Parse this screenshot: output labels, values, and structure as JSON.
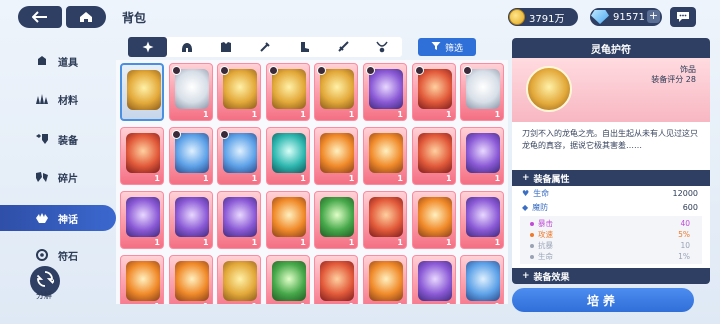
{
  "header": {
    "title": "背包",
    "back_icon": "arrow-left-icon",
    "home_icon": "home-icon",
    "gold": "3791万",
    "gems": "91571",
    "plus_label": "+",
    "chat_icon": "chat-icon"
  },
  "sidebar": {
    "items": [
      {
        "label": "道具",
        "icon": "items-icon"
      },
      {
        "label": "材料",
        "icon": "materials-icon"
      },
      {
        "label": "装备",
        "icon": "equipment-icon"
      },
      {
        "label": "碎片",
        "icon": "fragments-icon"
      },
      {
        "label": "神话",
        "icon": "mythic-icon",
        "active": true
      },
      {
        "label": "符石",
        "icon": "rune-icon"
      }
    ],
    "recycle_label": "分解"
  },
  "filter": {
    "tabs": [
      "all-icon",
      "helmet-icon",
      "armor-icon",
      "weapon-icon",
      "boots-icon",
      "sword-icon",
      "necklace-icon"
    ],
    "filter_label": "筛选"
  },
  "grid": {
    "items": [
      {
        "color": "gold",
        "qty": "",
        "selected": true,
        "mark": false
      },
      {
        "color": "silver",
        "qty": "1",
        "mark": true
      },
      {
        "color": "gold",
        "qty": "1",
        "mark": true
      },
      {
        "color": "gold",
        "qty": "1",
        "mark": true
      },
      {
        "color": "gold",
        "qty": "1",
        "mark": true
      },
      {
        "color": "purple",
        "qty": "1",
        "mark": true
      },
      {
        "color": "red",
        "qty": "1",
        "mark": true
      },
      {
        "color": "silver",
        "qty": "1",
        "mark": true
      },
      {
        "color": "red",
        "qty": "1",
        "mark": false
      },
      {
        "color": "blue",
        "qty": "1",
        "mark": true
      },
      {
        "color": "blue",
        "qty": "1",
        "mark": true
      },
      {
        "color": "cyan",
        "qty": "1",
        "mark": false
      },
      {
        "color": "orange",
        "qty": "1",
        "mark": false
      },
      {
        "color": "orange",
        "qty": "1",
        "mark": false
      },
      {
        "color": "red",
        "qty": "1",
        "mark": false
      },
      {
        "color": "purple",
        "qty": "1",
        "mark": false
      },
      {
        "color": "purple",
        "qty": "1",
        "mark": false
      },
      {
        "color": "purple",
        "qty": "1",
        "mark": false
      },
      {
        "color": "purple",
        "qty": "1",
        "mark": false
      },
      {
        "color": "orange",
        "qty": "1",
        "mark": false
      },
      {
        "color": "green",
        "qty": "1",
        "mark": false
      },
      {
        "color": "red",
        "qty": "1",
        "mark": false
      },
      {
        "color": "orange",
        "qty": "1",
        "mark": false
      },
      {
        "color": "purple",
        "qty": "1",
        "mark": false
      },
      {
        "color": "orange",
        "qty": "1",
        "mark": false
      },
      {
        "color": "orange",
        "qty": "1",
        "mark": false
      },
      {
        "color": "gold",
        "qty": "1",
        "mark": false
      },
      {
        "color": "green",
        "qty": "1",
        "mark": false
      },
      {
        "color": "red",
        "qty": "1",
        "mark": false
      },
      {
        "color": "orange",
        "qty": "1",
        "mark": false
      },
      {
        "color": "purple",
        "qty": "1",
        "mark": false
      },
      {
        "color": "blue",
        "qty": "1",
        "mark": false
      }
    ]
  },
  "detail": {
    "name": "灵龟护符",
    "type": "饰品",
    "score_label": "装备评分 28",
    "description": "刀剑不入的龙龟之壳。自出生起从未有人见过这只龙龟的真容，据说它极其害羞……",
    "attr_header": "装备属性",
    "attrs": [
      {
        "label": "生命",
        "value": "12000"
      },
      {
        "label": "魔防",
        "value": "600"
      }
    ],
    "sub_attrs": [
      {
        "label": "暴击",
        "value": "40",
        "color": "#c24bd6"
      },
      {
        "label": "攻速",
        "value": "5%",
        "color": "#f07a2a"
      },
      {
        "label": "抗暴",
        "value": "10",
        "color": "#9aa3b5"
      },
      {
        "label": "生命",
        "value": "1%",
        "color": "#9aa3b5"
      }
    ],
    "effect_header": "装备效果",
    "upgrade_label": "培养"
  }
}
